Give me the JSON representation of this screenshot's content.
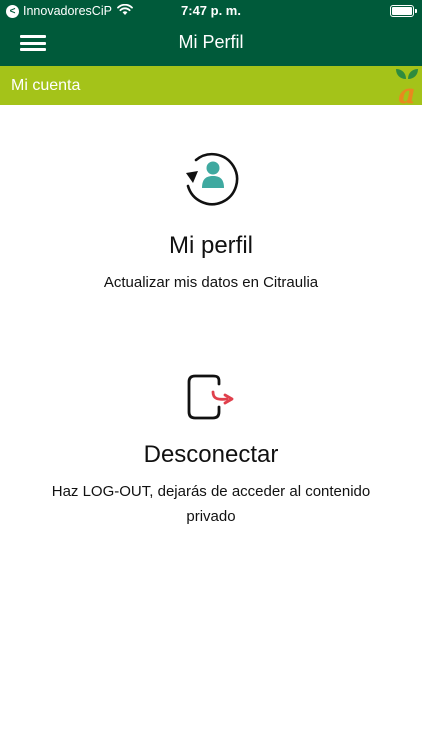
{
  "status_bar": {
    "back_glyph": "<",
    "carrier": "InnovadoresCiP",
    "time": "7:47 p. m."
  },
  "header": {
    "title": "Mi Perfil"
  },
  "account_bar": {
    "label": "Mi cuenta",
    "logo_text": "a"
  },
  "profile": {
    "title": "Mi perfil",
    "description": "Actualizar mis datos en Citraulia"
  },
  "logout": {
    "title": "Desconectar",
    "description": "Haz LOG-OUT, dejarás de acceder al contenido privado"
  },
  "colors": {
    "header_bg": "#005a3a",
    "account_bar_bg": "#a4c319",
    "profile_icon_teal": "#3fa9a0",
    "logout_arrow_red": "#e0404c",
    "logo_orange": "#e8891e",
    "logo_leaf_green": "#2e8b3e"
  },
  "icons": {
    "menu": "hamburger-icon",
    "profile": "profile-refresh-icon",
    "logout": "logout-icon",
    "wifi": "wifi-icon",
    "battery": "battery-icon"
  }
}
